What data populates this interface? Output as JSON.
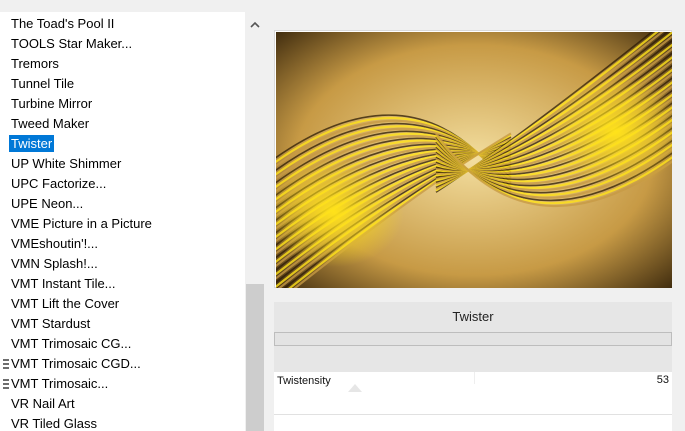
{
  "filters": {
    "items": [
      {
        "label": "The Toad's Pool II",
        "selected": false,
        "grip": false
      },
      {
        "label": "TOOLS Star Maker...",
        "selected": false,
        "grip": false
      },
      {
        "label": "Tremors",
        "selected": false,
        "grip": false
      },
      {
        "label": "Tunnel Tile",
        "selected": false,
        "grip": false
      },
      {
        "label": "Turbine Mirror",
        "selected": false,
        "grip": false
      },
      {
        "label": "Tweed Maker",
        "selected": false,
        "grip": false
      },
      {
        "label": "Twister",
        "selected": true,
        "grip": false
      },
      {
        "label": "UP White Shimmer",
        "selected": false,
        "grip": false
      },
      {
        "label": "UPC Factorize...",
        "selected": false,
        "grip": false
      },
      {
        "label": "UPE Neon...",
        "selected": false,
        "grip": false
      },
      {
        "label": "VME Picture in a Picture",
        "selected": false,
        "grip": false
      },
      {
        "label": "VMEshoutin'!...",
        "selected": false,
        "grip": false
      },
      {
        "label": "VMN Splash!...",
        "selected": false,
        "grip": false
      },
      {
        "label": "VMT Instant Tile...",
        "selected": false,
        "grip": false
      },
      {
        "label": "VMT Lift the Cover",
        "selected": false,
        "grip": false
      },
      {
        "label": "VMT Stardust",
        "selected": false,
        "grip": false
      },
      {
        "label": "VMT Trimosaic CG...",
        "selected": false,
        "grip": false
      },
      {
        "label": "VMT Trimosaic CGD...",
        "selected": false,
        "grip": true
      },
      {
        "label": "VMT Trimosaic...",
        "selected": false,
        "grip": true
      },
      {
        "label": "VR Nail Art",
        "selected": false,
        "grip": false
      },
      {
        "label": "VR Tiled Glass",
        "selected": false,
        "grip": false
      }
    ]
  },
  "colors": {
    "selection": "#0078d7",
    "gold_dark": "#2b1b06",
    "gold_mid": "#c79a45",
    "gold_light": "#f3de9f",
    "gold_bright": "#ffe21a"
  },
  "parameters": {
    "filter_title": "Twister",
    "rows": [
      {
        "name": "Twistensity",
        "value": "53"
      }
    ]
  },
  "icons": {
    "scroll_up": "chevron-up-icon"
  }
}
